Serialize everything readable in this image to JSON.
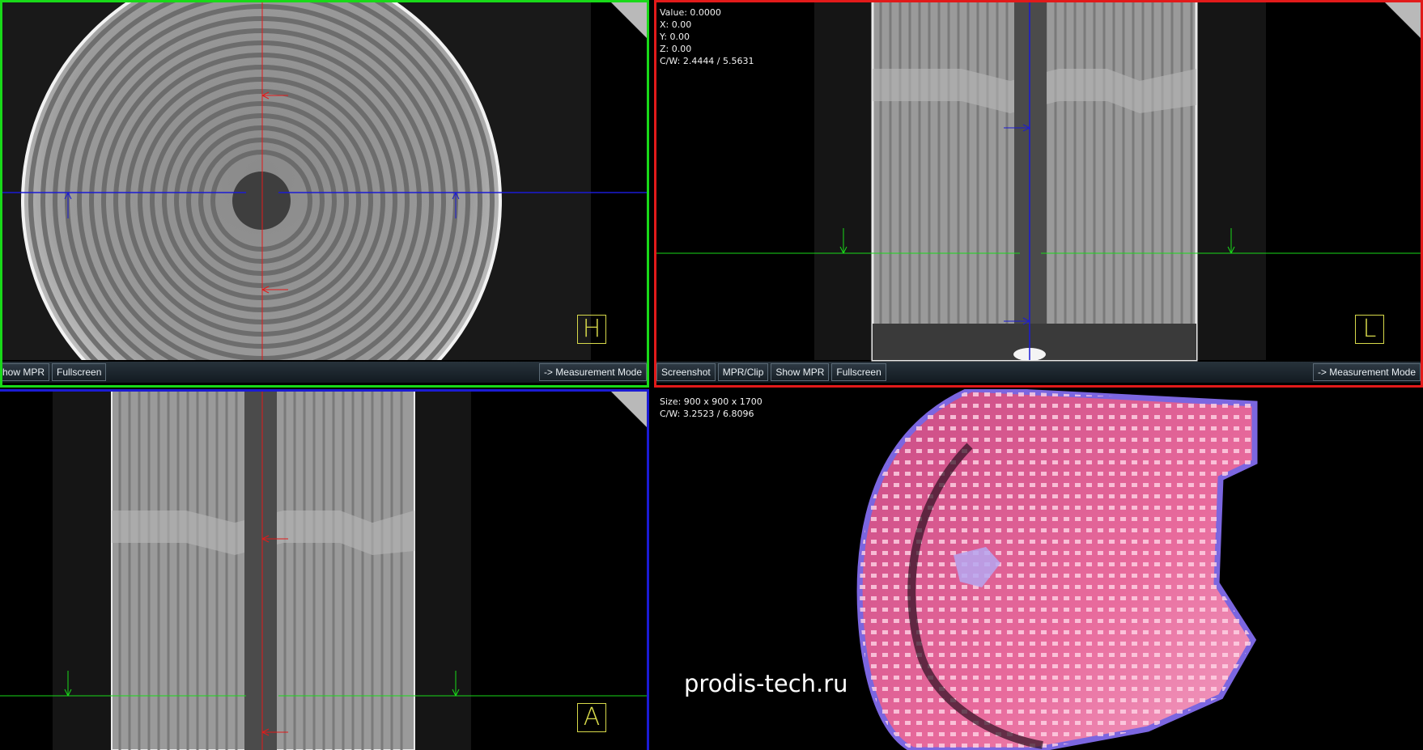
{
  "colors": {
    "view_h_border": "#19d919",
    "view_l_border": "#e21a1a",
    "view_a_border": "#1b1bd4",
    "crosshair_red": "#e21a1a",
    "crosshair_blue": "#1b1bd4",
    "crosshair_green": "#19d919",
    "orientation_marker": "#d7d94a",
    "volume_render_pink": "#e86a9c"
  },
  "view_h": {
    "orientation_marker": "H",
    "toolbar": {
      "show_mpr": "how MPR",
      "fullscreen": "Fullscreen",
      "measurement_mode": "-> Measurement Mode"
    }
  },
  "view_l": {
    "orientation_marker": "L",
    "info": {
      "value": "Value: 0.0000",
      "x": "X: 0.00",
      "y": "Y: 0.00",
      "z": "Z: 0.00",
      "cw": "C/W: 2.4444 / 5.5631"
    },
    "toolbar": {
      "screenshot": "Screenshot",
      "mpr_clip": "MPR/Clip",
      "show_mpr": "Show MPR",
      "fullscreen": "Fullscreen",
      "measurement_mode": "-> Measurement Mode"
    }
  },
  "view_a": {
    "orientation_marker": "A"
  },
  "view_3d": {
    "info": {
      "size": "Size: 900 x 900 x 1700",
      "cw": "C/W: 3.2523 / 6.8096"
    },
    "watermark": "prodis-tech.ru"
  }
}
